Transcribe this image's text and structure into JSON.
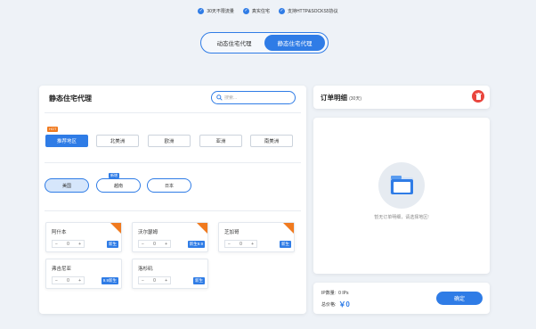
{
  "features": [
    "30天不限流量",
    "真实住宅",
    "支持HTTP&SOCKS5协议"
  ],
  "proxy_toggle": {
    "dynamic": "动态住宅代理",
    "static": "静态住宅代理"
  },
  "left_panel": {
    "title": "静态住宅代理",
    "search_placeholder": "搜索...",
    "hot_badge": "HOT",
    "regions": [
      "推荐地区",
      "北美洲",
      "欧洲",
      "亚洲",
      "南美洲"
    ],
    "new_badge": "新增",
    "countries": [
      "美国",
      "越南",
      "日本"
    ],
    "cards": [
      {
        "name": "阿什本",
        "qty": "0",
        "price": "新生"
      },
      {
        "name": "沃尔瑟姆",
        "qty": "0",
        "price": "新生9.9"
      },
      {
        "name": "芝加哥",
        "qty": "0",
        "price": "新生"
      },
      {
        "name": "弗吉尼亚",
        "qty": "0",
        "price": "9.9新生"
      },
      {
        "name": "洛杉矶",
        "qty": "0",
        "price": "新生"
      }
    ],
    "minus": "−",
    "plus": "+"
  },
  "order": {
    "title": "订单明细",
    "days": "(30天)",
    "empty_text": "暂无订单明细，请选择地区!",
    "ip_label": "IP数量:",
    "ip_value": "0 IPs",
    "total_label": "总价格:",
    "total_value": "￥0",
    "confirm": "确定"
  },
  "colors": {
    "accent": "#2f7ce6",
    "hot": "#f07a1f",
    "delete": "#e9453d"
  }
}
